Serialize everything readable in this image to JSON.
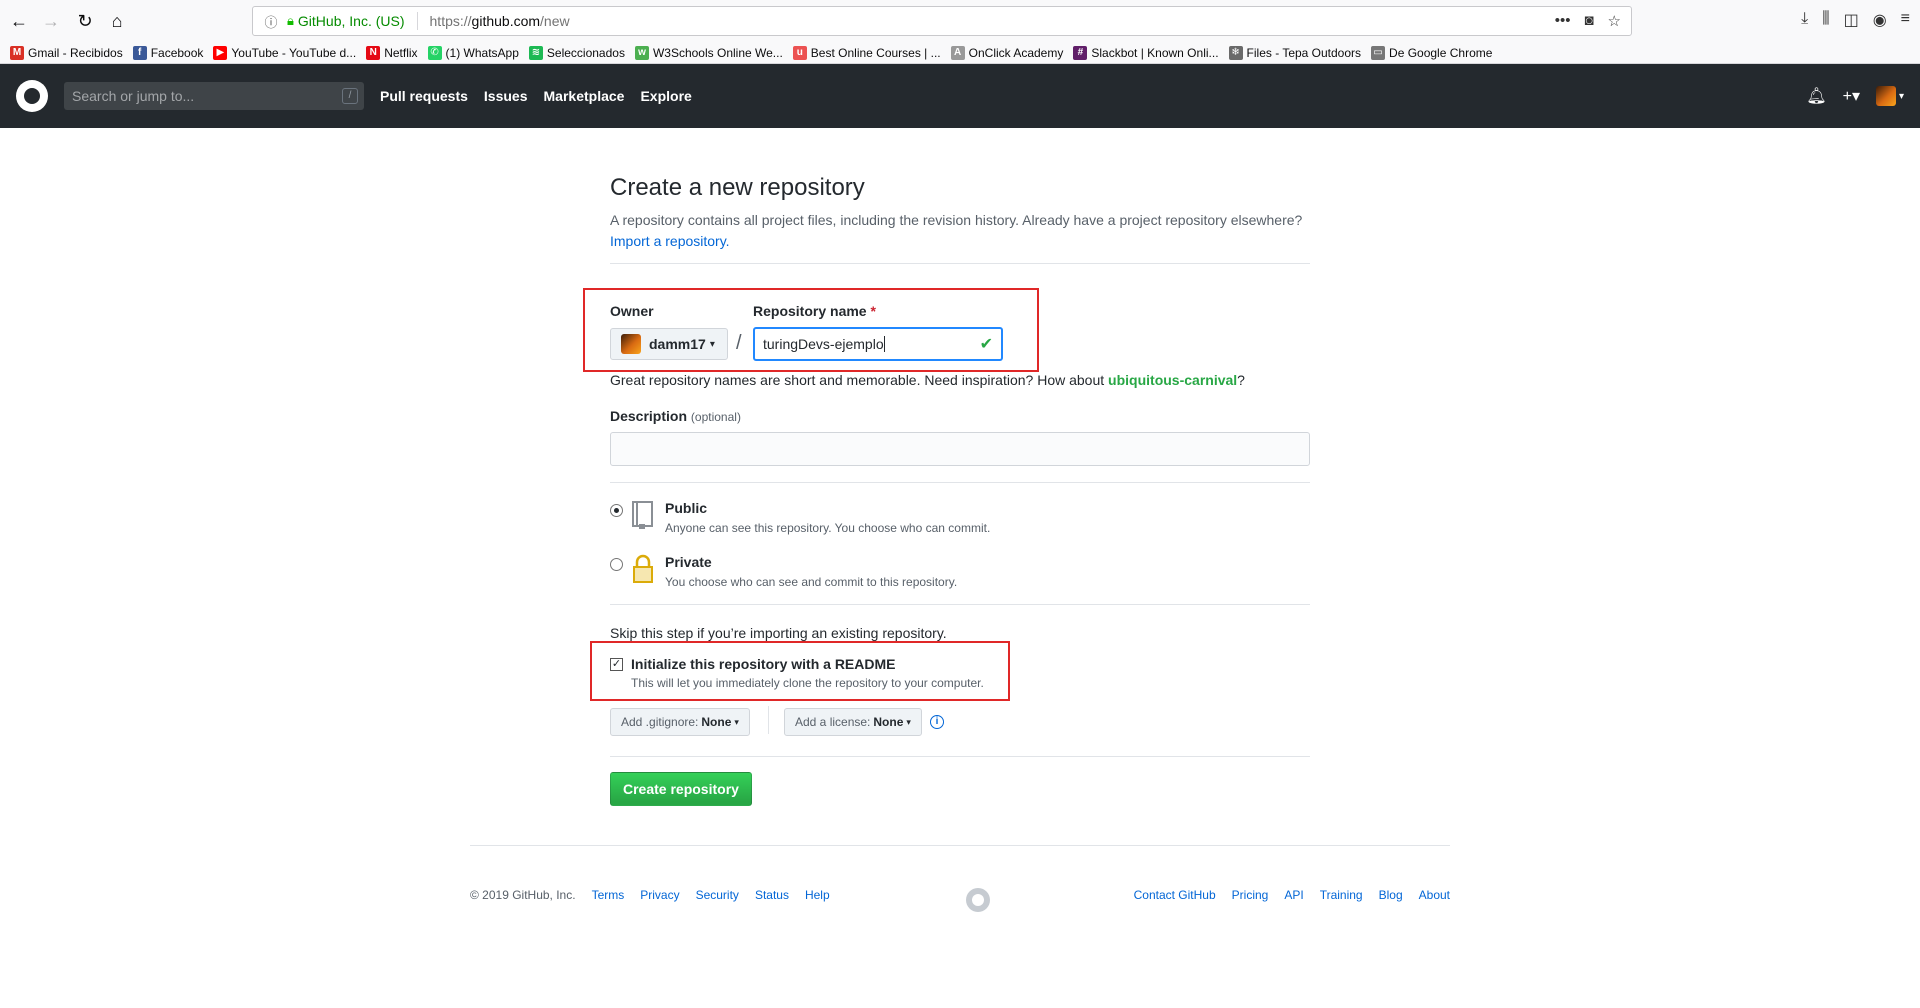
{
  "browser": {
    "org_label": "GitHub, Inc. (US)",
    "url_prefix": "https://",
    "url_host": "github.com",
    "url_path": "/new",
    "bookmarks": [
      {
        "label": "Gmail - Recibidos",
        "icon": "gmail-icon",
        "color": "#d93025",
        "glyph": "M"
      },
      {
        "label": "Facebook",
        "icon": "facebook-icon",
        "color": "#3b5998",
        "glyph": "f"
      },
      {
        "label": "YouTube - YouTube d...",
        "icon": "youtube-icon",
        "color": "#ff0000",
        "glyph": "▶"
      },
      {
        "label": "Netflix",
        "icon": "netflix-icon",
        "color": "#e50914",
        "glyph": "N"
      },
      {
        "label": "(1) WhatsApp",
        "icon": "whatsapp-icon",
        "color": "#25d366",
        "glyph": "✆"
      },
      {
        "label": "Seleccionados",
        "icon": "spotify-icon",
        "color": "#1db954",
        "glyph": "≋"
      },
      {
        "label": "W3Schools Online We...",
        "icon": "w3schools-icon",
        "color": "#4caf50",
        "glyph": "w"
      },
      {
        "label": "Best Online Courses | ...",
        "icon": "udemy-icon",
        "color": "#ec5252",
        "glyph": "u"
      },
      {
        "label": "OnClick Academy",
        "icon": "onclick-icon",
        "color": "#999999",
        "glyph": "A"
      },
      {
        "label": "Slackbot | Known Onli...",
        "icon": "slack-icon",
        "color": "#611f69",
        "glyph": "#"
      },
      {
        "label": "Files - Tepa Outdoors",
        "icon": "files-icon",
        "color": "#6a6a6a",
        "glyph": "❄"
      },
      {
        "label": "De Google Chrome",
        "icon": "folder-icon",
        "color": "#777777",
        "glyph": "▭"
      }
    ]
  },
  "header": {
    "search_placeholder": "Search or jump to...",
    "slash_key": "/",
    "nav": [
      "Pull requests",
      "Issues",
      "Marketplace",
      "Explore"
    ]
  },
  "main": {
    "title": "Create a new repository",
    "subtitle": "A repository contains all project files, including the revision history. Already have a project repository elsewhere?",
    "import_link": "Import a repository.",
    "owner_label": "Owner",
    "repo_name_label": "Repository name",
    "required_mark": "*",
    "owner_value": "damm17",
    "slash": "/",
    "repo_name_value": "turingDevs-ejemplo",
    "hint_prefix": "Great repository names are short and memorable. Need inspiration? How about",
    "hint_suggestion": "ubiquitous-carnival",
    "hint_suffix": "?",
    "description_label": "Description",
    "description_optional": "(optional)",
    "description_value": "",
    "visibility": [
      {
        "title": "Public",
        "sub": "Anyone can see this repository. You choose who can commit.",
        "selected": true
      },
      {
        "title": "Private",
        "sub": "You choose who can see and commit to this repository.",
        "selected": false
      }
    ],
    "skip_text": "Skip this step if you’re importing an existing repository.",
    "readme_title": "Initialize this repository with a README",
    "readme_sub": "This will let you immediately clone the repository to your computer.",
    "readme_checked": true,
    "gitignore_label": "Add .gitignore:",
    "gitignore_value": "None",
    "license_label": "Add a license:",
    "license_value": "None",
    "create_button": "Create repository"
  },
  "footer": {
    "copyright": "© 2019 GitHub, Inc.",
    "left_links": [
      "Terms",
      "Privacy",
      "Security",
      "Status",
      "Help"
    ],
    "right_links": [
      "Contact GitHub",
      "Pricing",
      "API",
      "Training",
      "Blog",
      "About"
    ]
  }
}
